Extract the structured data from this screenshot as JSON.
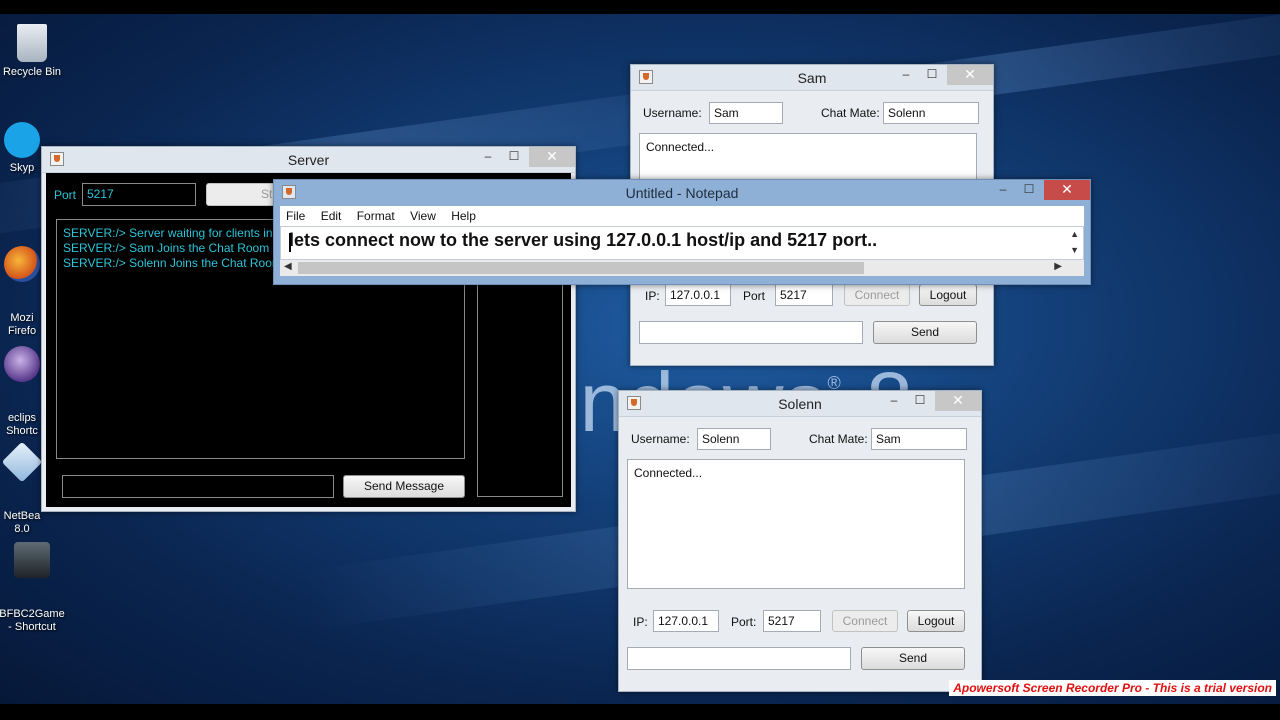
{
  "desktop": {
    "icons": [
      {
        "label": "Recycle Bin",
        "icon": "recycle-bin-icon"
      },
      {
        "label": "Skyp",
        "icon": "skype-icon"
      },
      {
        "label": "Mozi\nFirefo",
        "icon": "firefox-icon"
      },
      {
        "label": "eclips\nShortc",
        "icon": "eclipse-icon"
      },
      {
        "label": "NetBea\n8.0",
        "icon": "netbeans-icon"
      },
      {
        "label": "BFBC2Game\n- Shortcut",
        "icon": "bfbc2-icon"
      }
    ],
    "wallpaper_text": "indows",
    "wallpaper_mark": "®",
    "wallpaper_number": "8"
  },
  "server": {
    "title": "Server",
    "port_label": "Port",
    "port_value": "5217",
    "start_button": "St",
    "log": [
      "SERVER:/> Server waiting for clients in po",
      "SERVER:/> Sam Joins the Chat Room",
      "SERVER:/> Solenn Joins the Chat Room"
    ],
    "message_value": "",
    "send_button": "Send Message"
  },
  "sam": {
    "title": "Sam",
    "username_label": "Username:",
    "username_value": "Sam",
    "chatmate_label": "Chat Mate:",
    "chatmate_value": "Solenn",
    "messages": "Connected...",
    "ip_label": "IP:",
    "ip_value": "127.0.0.1",
    "port_label": "Port",
    "port_value": "5217",
    "connect_button": "Connect",
    "logout_button": "Logout",
    "send_button": "Send"
  },
  "solenn": {
    "title": "Solenn",
    "username_label": "Username:",
    "username_value": "Solenn",
    "chatmate_label": "Chat Mate:",
    "chatmate_value": "Sam",
    "messages": "Connected...",
    "ip_label": "IP:",
    "ip_value": "127.0.0.1",
    "port_label": "Port:",
    "port_value": "5217",
    "connect_button": "Connect",
    "logout_button": "Logout",
    "send_button": "Send"
  },
  "notepad": {
    "title": "Untitled - Notepad",
    "menu": [
      "File",
      "Edit",
      "Format",
      "View",
      "Help"
    ],
    "text": "lets connect now to the server using 127.0.0.1 host/ip and 5217 port.."
  },
  "window_controls": {
    "minimize": "–",
    "maximize": "☐",
    "close": "✕"
  },
  "watermark": "Apowersoft Screen Recorder Pro - This is a trial version"
}
